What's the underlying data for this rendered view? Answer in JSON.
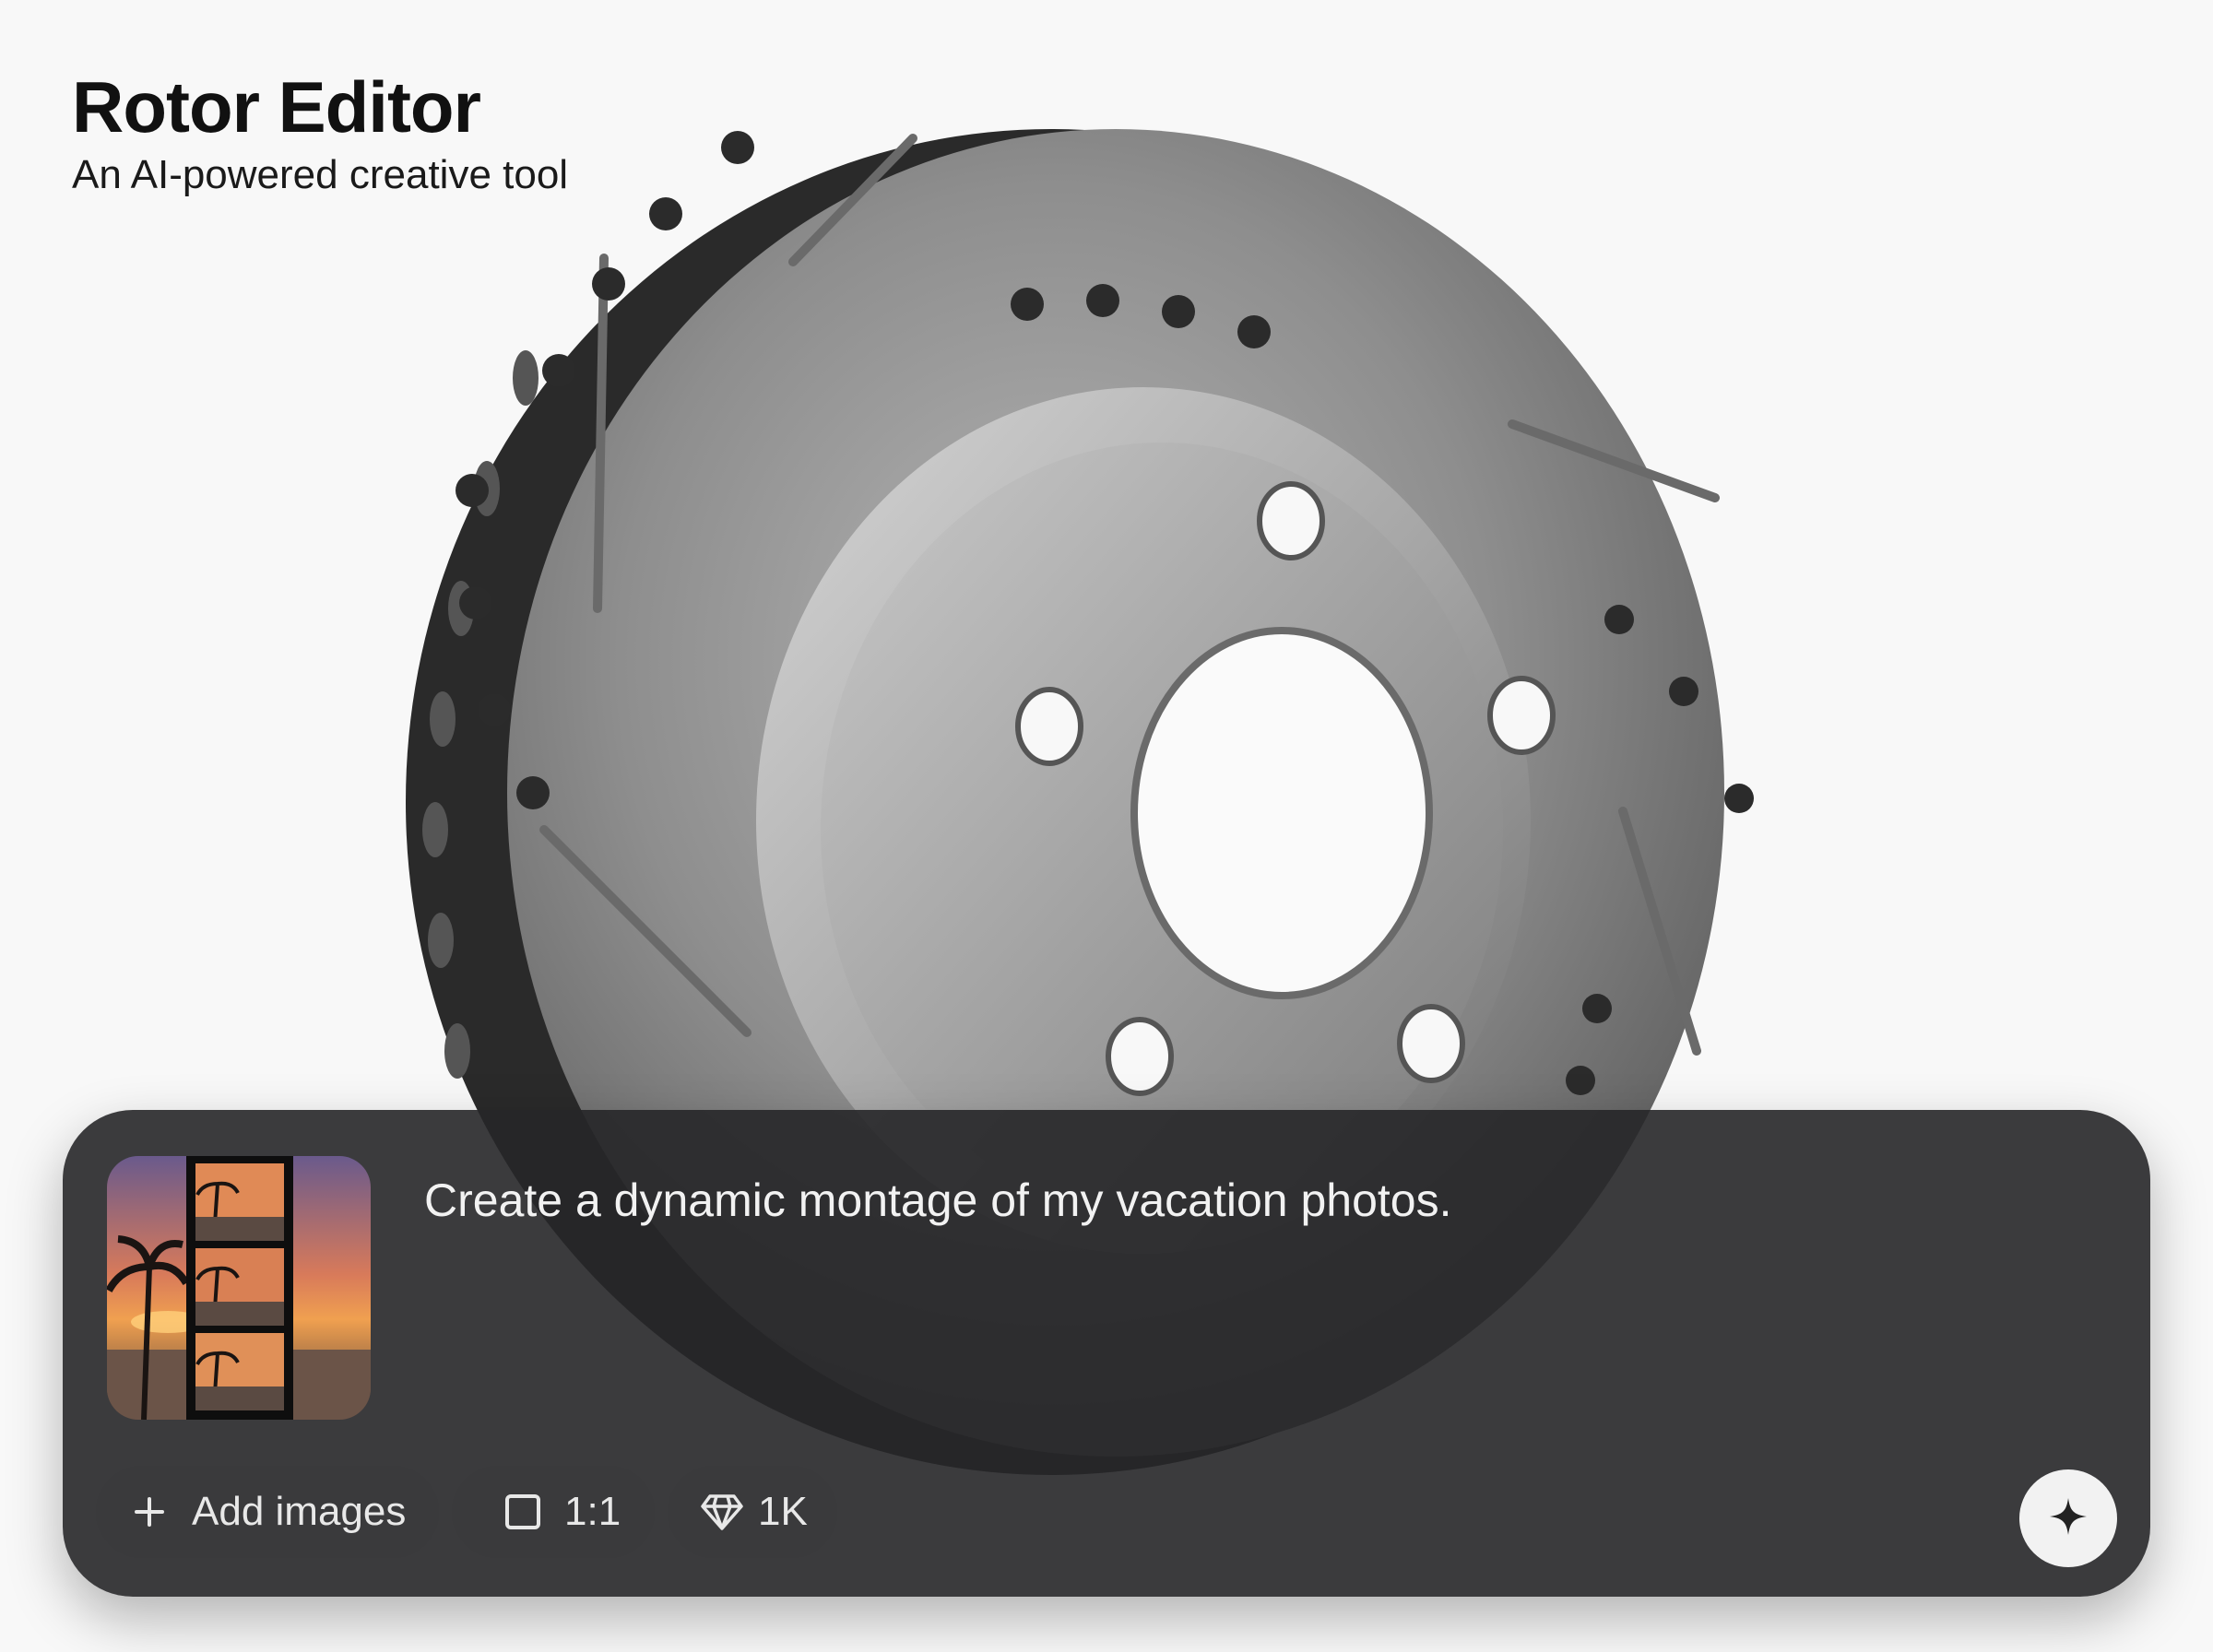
{
  "app": {
    "title": "Rotor Editor",
    "subtitle": "An AI-powered creative tool"
  },
  "composer": {
    "prompt": "Create a dynamic montage of my vacation photos.",
    "attachment_icon": "photo-filmstrip-thumbnail",
    "add_images_label": "Add images",
    "aspect_ratio_label": "1:1",
    "resolution_label": "1K",
    "send_icon": "sparkle-icon"
  },
  "colors": {
    "panel_bg": "#262628",
    "chip_bg": "#3a3a3c",
    "send_bg": "#f2f2f2",
    "rotor_metal": "#8a8a8a"
  }
}
